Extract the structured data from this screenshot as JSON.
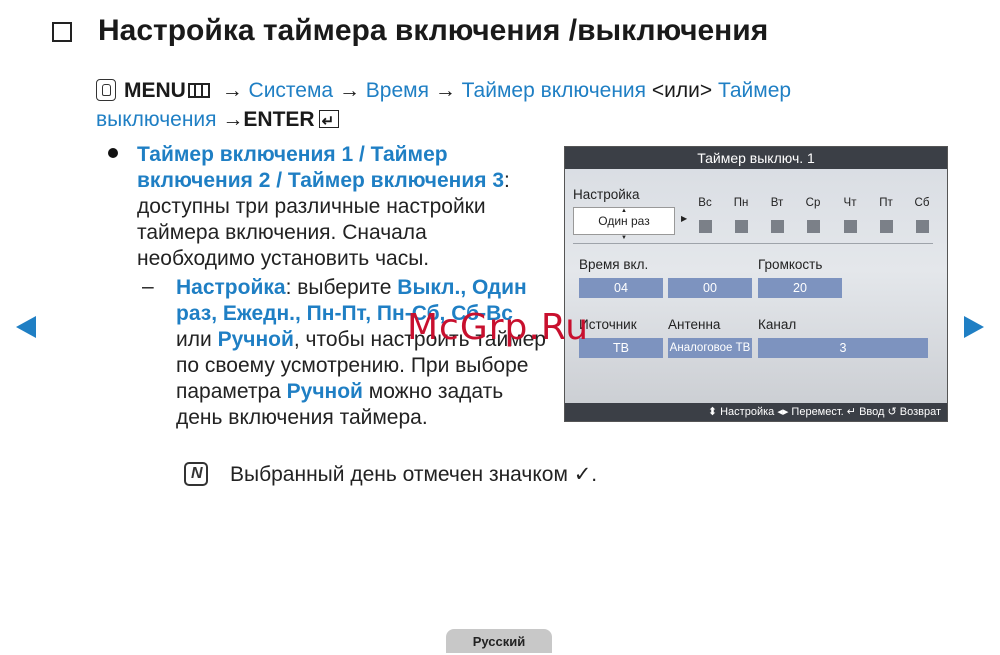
{
  "heading": {
    "title": "Настройка таймера включения /выключения"
  },
  "path": {
    "menu": "MENU",
    "arrow": "→",
    "system": "Система",
    "time": "Время",
    "timer_on": "Таймер включения",
    "or": "<или>",
    "timer_off_1": "Таймер",
    "timer_off_2": "выключения",
    "enter": "→ENTER"
  },
  "body": {
    "bullet_title": "Таймер включения 1 / Таймер включения 2 / Таймер включения 3",
    "bullet_text": ": доступны три различные настройки таймера включения. Сначала необходимо установить часы.",
    "dash": "–",
    "sub_label": "Настройка",
    "sub_text1": ": выберите ",
    "sub_options": "Выкл., Один раз, Ежедн., Пн-Пт, Пн-Сб, Сб-Вс",
    "sub_text2": " или ",
    "sub_manual": "Ручной",
    "sub_text3": ", чтобы настроить таймер по своему усмотрению. При выборе параметра ",
    "sub_manual2": "Ручной",
    "sub_text4": " можно задать день включения таймера.",
    "note": "Выбранный день отмечен значком ✓."
  },
  "watermark": "McGrp.Ru",
  "tv": {
    "title": "Таймер выключ. 1",
    "setup_label": "Настройка",
    "setup_value": "Один раз",
    "days": [
      "Вс",
      "Пн",
      "Вт",
      "Ср",
      "Чт",
      "Пт",
      "Сб"
    ],
    "time_label": "Время вкл.",
    "volume_label": "Громкость",
    "hour": "04",
    "minute": "00",
    "volume": "20",
    "source_label": "Источник",
    "antenna_label": "Антенна",
    "channel_label": "Канал",
    "source": "ТВ",
    "antenna": "Аналоговое ТВ",
    "channel": "3",
    "footer": "⬍ Настройка  ◂▸ Перемест.  ↵ Ввод  ↺ Возврат"
  },
  "footer": {
    "language": "Русский"
  }
}
